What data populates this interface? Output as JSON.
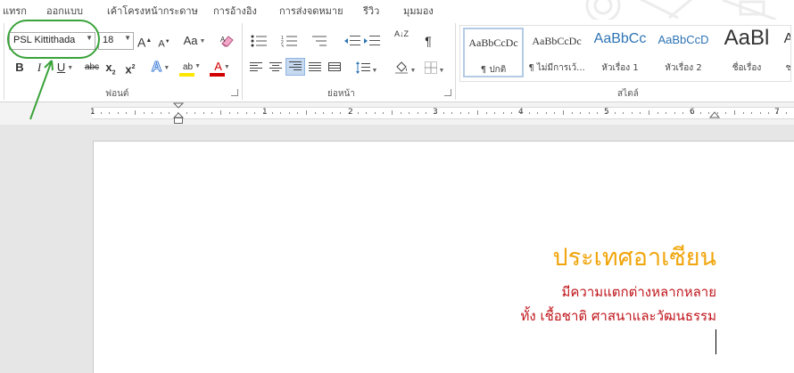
{
  "tabs": [
    "แทรก",
    "ออกแบบ",
    "เค้าโครงหน้ากระดาษ",
    "การอ้างอิง",
    "การส่งจดหมาย",
    "รีวิว",
    "มุมมอง"
  ],
  "font": {
    "name": "PSL Kittithada",
    "size": "18",
    "grow": "A",
    "shrink": "A",
    "change_case": "Aa",
    "bold": "B",
    "italic": "I",
    "underline": "U",
    "strike": "abc",
    "subscript": "x",
    "sub_mark": "2",
    "superscript": "x",
    "super_mark": "2",
    "effects": "A",
    "highlight": "ab",
    "color": "A",
    "highlight_color": "#ffe600",
    "font_color": "#d00000"
  },
  "groups": {
    "font": "ฟอนต์",
    "paragraph": "ย่อหน้า",
    "styles": "สไตล์"
  },
  "paragraph": {
    "sort": "A↓Z",
    "pilcrow": "¶"
  },
  "styles": [
    {
      "preview": "AaBbCcDc",
      "name": "¶ ปกติ",
      "color": "#000000"
    },
    {
      "preview": "AaBbCcDc",
      "name": "¶ ไม่มีการเว้...",
      "color": "#000000"
    },
    {
      "preview": "AaBbCc",
      "name": "หัวเรื่อง 1",
      "color": "#2e74b5"
    },
    {
      "preview": "AaBbCcD",
      "name": "หัวเรื่อง 2",
      "color": "#2e74b5"
    },
    {
      "preview": "AaBl",
      "name": "ชื่อเรื่อง",
      "color": "#000000"
    },
    {
      "preview": "A",
      "name": "ช",
      "color": "#000000"
    }
  ],
  "ruler": {
    "numbers": [
      "1",
      "1",
      "2",
      "3",
      "4",
      "5",
      "6",
      "7"
    ]
  },
  "document": {
    "title": "ประเทศอาเซียน",
    "line1": "มีความแตกต่างหลากหลาย",
    "line2": "ทั้ง เชื้อชาติ ศาสนาและวัฒนธรรม",
    "title_color": "#f0a50c",
    "text_color": "#c0151b"
  },
  "annotation": {
    "color": "#3aa33a"
  }
}
